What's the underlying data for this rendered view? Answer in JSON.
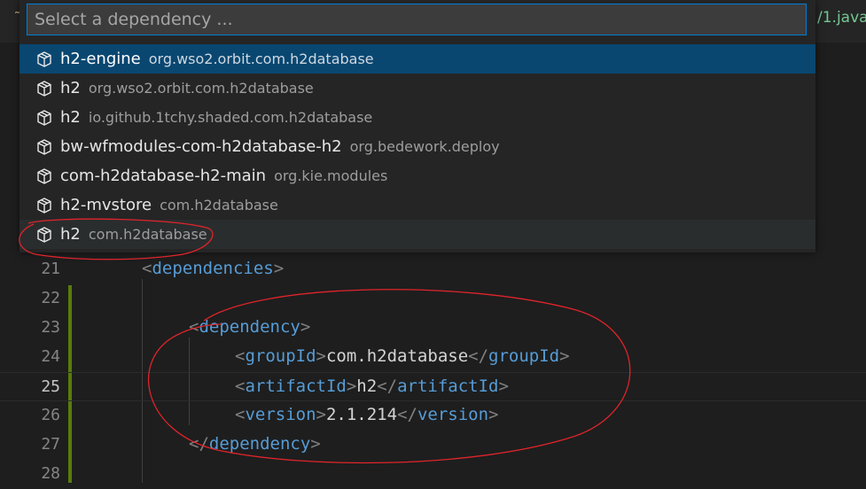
{
  "window": {
    "tab_marker": "˜",
    "tab_right_text": "/1.java"
  },
  "quick_pick": {
    "placeholder": "Select a dependency ...",
    "items": [
      {
        "label": "h2-engine",
        "description": "org.wso2.orbit.com.h2database",
        "state": "selected"
      },
      {
        "label": "h2",
        "description": "org.wso2.orbit.com.h2database",
        "state": "normal"
      },
      {
        "label": "h2",
        "description": "io.github.1tchy.shaded.com.h2database",
        "state": "normal"
      },
      {
        "label": "bw-wfmodules-com-h2database-h2",
        "description": "org.bedework.deploy",
        "state": "normal"
      },
      {
        "label": "com-h2database-h2-main",
        "description": "org.kie.modules",
        "state": "normal"
      },
      {
        "label": "h2-mvstore",
        "description": "com.h2database",
        "state": "normal"
      },
      {
        "label": "h2",
        "description": "com.h2database",
        "state": "hovered"
      }
    ],
    "item_icon": "package-icon"
  },
  "editor": {
    "lines": [
      {
        "number": "21",
        "active": false
      },
      {
        "number": "22",
        "active": false
      },
      {
        "number": "23",
        "active": false
      },
      {
        "number": "24",
        "active": false
      },
      {
        "number": "25",
        "active": true
      },
      {
        "number": "26",
        "active": false
      },
      {
        "number": "27",
        "active": false
      },
      {
        "number": "28",
        "active": false
      }
    ],
    "code": {
      "dependencies_tag": "dependencies",
      "dependency_tag": "dependency",
      "groupId_tag": "groupId",
      "groupId_value": "com.h2database",
      "artifactId_tag": "artifactId",
      "artifactId_value": "h2",
      "version_tag": "version",
      "version_value": "2.1.214"
    }
  },
  "colors": {
    "accent": "#007fd4",
    "selection": "#094771",
    "xml_tag": "#569cd6",
    "annotation": "#e0242b",
    "modified_gutter": "#587c0c"
  }
}
